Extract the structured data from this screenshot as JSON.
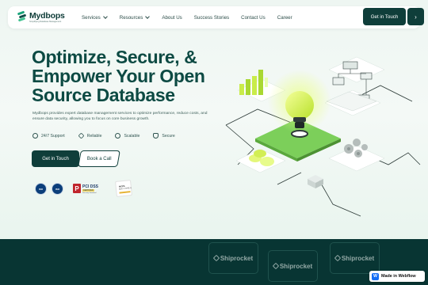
{
  "brand": {
    "name": "Mydbops",
    "tagline": "Simplifying Database Management"
  },
  "nav": {
    "items": [
      {
        "label": "Services",
        "dropdown": true
      },
      {
        "label": "Resources",
        "dropdown": true
      },
      {
        "label": "About Us",
        "dropdown": false
      },
      {
        "label": "Success Stories",
        "dropdown": false
      },
      {
        "label": "Contact Us",
        "dropdown": false
      },
      {
        "label": "Career",
        "dropdown": false
      }
    ],
    "cta_label": "Get in Touch",
    "arrow_glyph": "›"
  },
  "hero": {
    "headline_lines": [
      "Optimize, Secure, &",
      "Empower Your Open",
      "Source Database"
    ],
    "description": "Mydbops provides expert database management services to optimize performance, reduce costs, and ensure data security, allowing you to focus on core business growth.",
    "features": [
      {
        "label": "24/7 Support",
        "icon": "headset-icon"
      },
      {
        "label": "Reliable",
        "icon": "heart-icon"
      },
      {
        "label": "Scalable",
        "icon": "gauge-icon"
      },
      {
        "label": "Secure",
        "icon": "shield-icon"
      }
    ],
    "primary_button": "Get in Touch",
    "secondary_button": "Book a Call"
  },
  "certifications": {
    "iso_badge_1": "ISO",
    "iso_badge_2": "ISO",
    "pci": {
      "mark": "P",
      "title": "PCI DSS",
      "status": "CERTIFIED",
      "sub": "Security Standard"
    },
    "aicpa": {
      "title": "AICPA",
      "subtitle": "SOC 2 TYPE II"
    }
  },
  "clients": {
    "logos": [
      "Shiprocket",
      "Shiprocket",
      "Shiprocket"
    ]
  },
  "webflow_badge": {
    "label": "Made in Webflow",
    "glyph": "W"
  },
  "colors": {
    "primary": "#0f3e3a",
    "accent": "#1aa37a",
    "dark_section": "#083533"
  }
}
